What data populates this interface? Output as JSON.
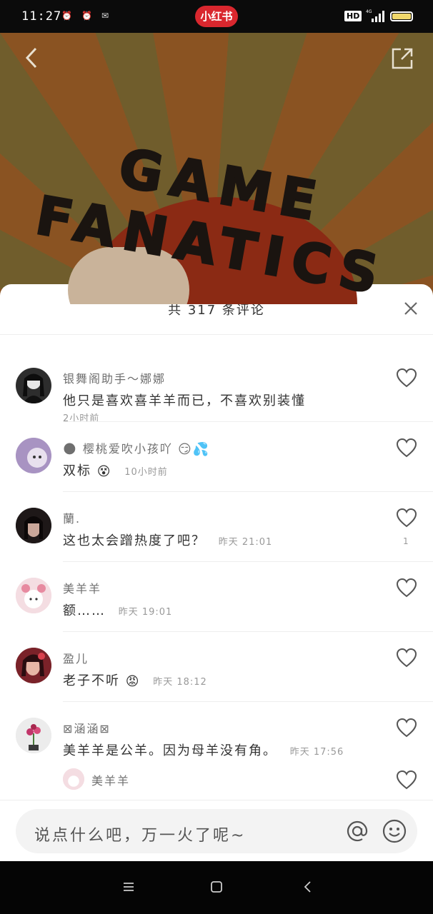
{
  "status_bar": {
    "time": "11:27",
    "notif_icons": [
      "⏰",
      "⏰",
      "✉"
    ],
    "app_badge": "小红书",
    "hd": "HD",
    "network": "4G"
  },
  "hero": {
    "title": "GAME FANATICS"
  },
  "comments_sheet": {
    "title": "共 317 条评论",
    "comments": [
      {
        "user": "银舞阁助手～娜娜",
        "text": "他只是喜欢喜羊羊而已，不喜欢别装懂",
        "time": "2小时前",
        "likes": ""
      },
      {
        "user": "樱桃爱吹小孩吖",
        "user_prefix_emoji": "🌑",
        "user_suffix_emoji": "😏💦",
        "text": "双标",
        "text_emoji": "😵",
        "time": "10小时前",
        "likes": ""
      },
      {
        "user": "蘭.",
        "text": "这也太会蹭热度了吧？",
        "time": "昨天 21:01",
        "likes": "1"
      },
      {
        "user": "美羊羊",
        "text": "额……",
        "time": "昨天 19:01",
        "likes": ""
      },
      {
        "user": "盈儿",
        "text": "老子不听",
        "text_emoji": "😡",
        "time": "昨天 18:12",
        "likes": ""
      },
      {
        "user": "⊠涵涵⊠",
        "text": "美羊羊是公羊。因为母羊没有角。",
        "time": "昨天 17:56",
        "likes": ""
      },
      {
        "user": "美羊羊",
        "text": "",
        "time": "",
        "likes": ""
      }
    ]
  },
  "input_bar": {
    "placeholder": "说点什么吧，万一火了呢~"
  },
  "colors": {
    "brand_red": "#d9272e",
    "sheet_bg": "#ffffff",
    "muted_text": "#999999"
  },
  "icons": [
    "back-icon",
    "share-icon",
    "close-icon",
    "heart-icon",
    "at-icon",
    "emoji-icon",
    "menu-icon",
    "home-icon",
    "nav-back-icon"
  ]
}
